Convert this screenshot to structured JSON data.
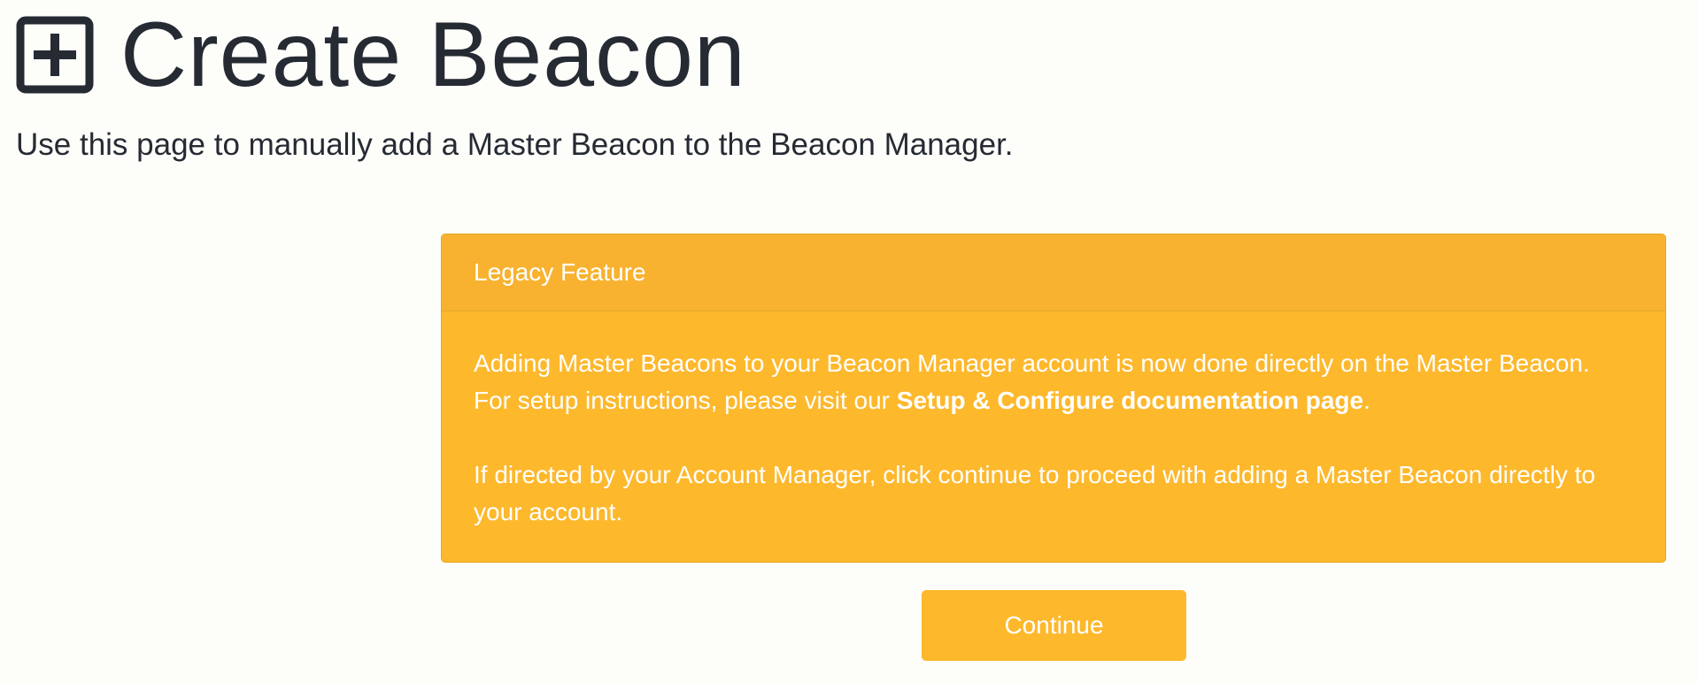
{
  "header": {
    "title": "Create Beacon",
    "icon": "plus-square-icon",
    "subtitle": "Use this page to manually add a Master Beacon to the Beacon Manager."
  },
  "panel": {
    "heading": "Legacy Feature",
    "paragraph1_text": "Adding Master Beacons to your Beacon Manager account is now done directly on the Master Beacon. For setup instructions, please visit our ",
    "paragraph1_link": "Setup & Configure documentation page",
    "paragraph1_end": ".",
    "paragraph2": "If directed by your Account Manager, click continue to proceed with adding a Master Beacon directly to your account."
  },
  "actions": {
    "continue_label": "Continue"
  },
  "colors": {
    "accent": "#fdb82c",
    "panel_heading": "#f8b22f",
    "text_dark": "#262a33",
    "background": "#fdfdfa"
  }
}
